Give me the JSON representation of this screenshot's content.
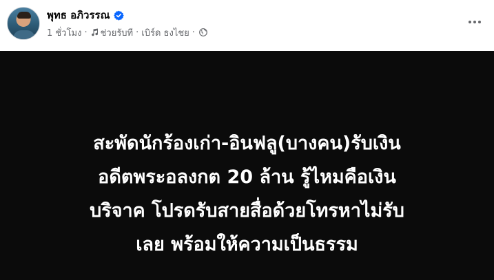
{
  "post": {
    "author_name": "พุทธ อภิวรรณ",
    "time": "1 ชั่วโมง",
    "separator": "·",
    "music_label": "ช่วยรับที",
    "artist": "เบิร์ด ธงไชย",
    "icons": {
      "verified": "verified-badge-icon",
      "music": "music-note-icon",
      "audience": "globe-icon",
      "more": "more-horizontal-icon"
    },
    "colors": {
      "verified_blue": "#0866ff",
      "meta_gray": "#65676b",
      "image_background": "#0b0b0b",
      "image_text": "#ffffff"
    }
  },
  "image": {
    "lines": [
      "สะพัดนักร้องเก่า-อินฟลู(บางคน)รับเงิน",
      "อดีตพระอลงกต 20 ล้าน รู้ไหมคือเงิน",
      "บริจาค โปรดรับสายสื่อด้วยโทรหาไม่รับ",
      "เลย พร้อมให้ความเป็นธรรม"
    ]
  }
}
